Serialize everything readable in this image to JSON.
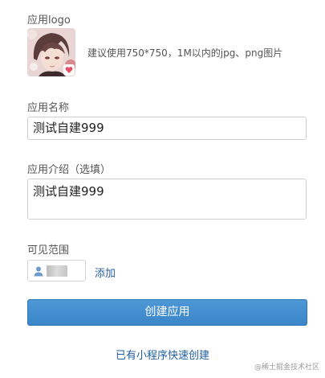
{
  "logo_section": {
    "label": "应用logo",
    "hint": "建议使用750*750，1M以内的jpg、png图片"
  },
  "name_section": {
    "label": "应用名称",
    "value": "测试自建999"
  },
  "desc_section": {
    "label": "应用介绍（选填）",
    "value": "测试自建999"
  },
  "visibility_section": {
    "label": "可见范围",
    "add_label": "添加"
  },
  "submit_button": {
    "label": "创建应用"
  },
  "quick_create": {
    "label": "已有小程序快速创建"
  },
  "watermark": {
    "text": "@稀土掘金技术社区"
  },
  "colors": {
    "primary": "#3a86c8",
    "link": "#1d5e9f"
  }
}
